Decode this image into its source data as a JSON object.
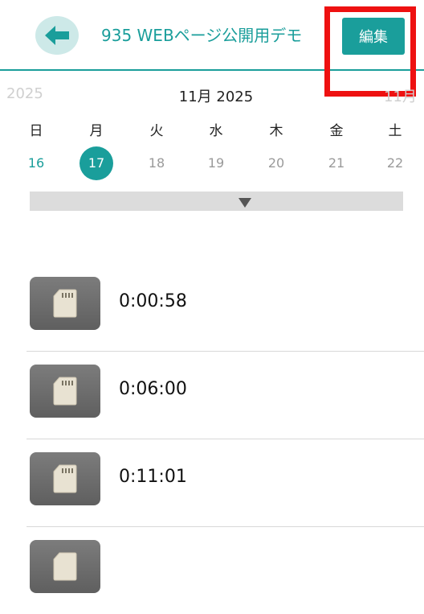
{
  "header": {
    "back_icon": "arrow-left-icon",
    "title": "935 WEBページ公開用デモ",
    "edit_label": "編集",
    "accent_color": "#1a9e9b",
    "highlight_color": "#ee1111"
  },
  "calendar": {
    "prev_label": "2025",
    "current_label": "11月 2025",
    "next_label": "11月",
    "weekdays": [
      "日",
      "月",
      "火",
      "水",
      "木",
      "金",
      "土"
    ],
    "days": [
      "16",
      "17",
      "18",
      "19",
      "20",
      "21",
      "22"
    ],
    "selected_day": "17",
    "expand_icon": "triangle-down-icon"
  },
  "recordings": [
    {
      "time": "0:00:58",
      "icon": "sd-card-icon"
    },
    {
      "time": "0:06:00",
      "icon": "sd-card-icon"
    },
    {
      "time": "0:11:01",
      "icon": "sd-card-icon"
    },
    {
      "time": "",
      "icon": "sd-card-icon"
    }
  ]
}
